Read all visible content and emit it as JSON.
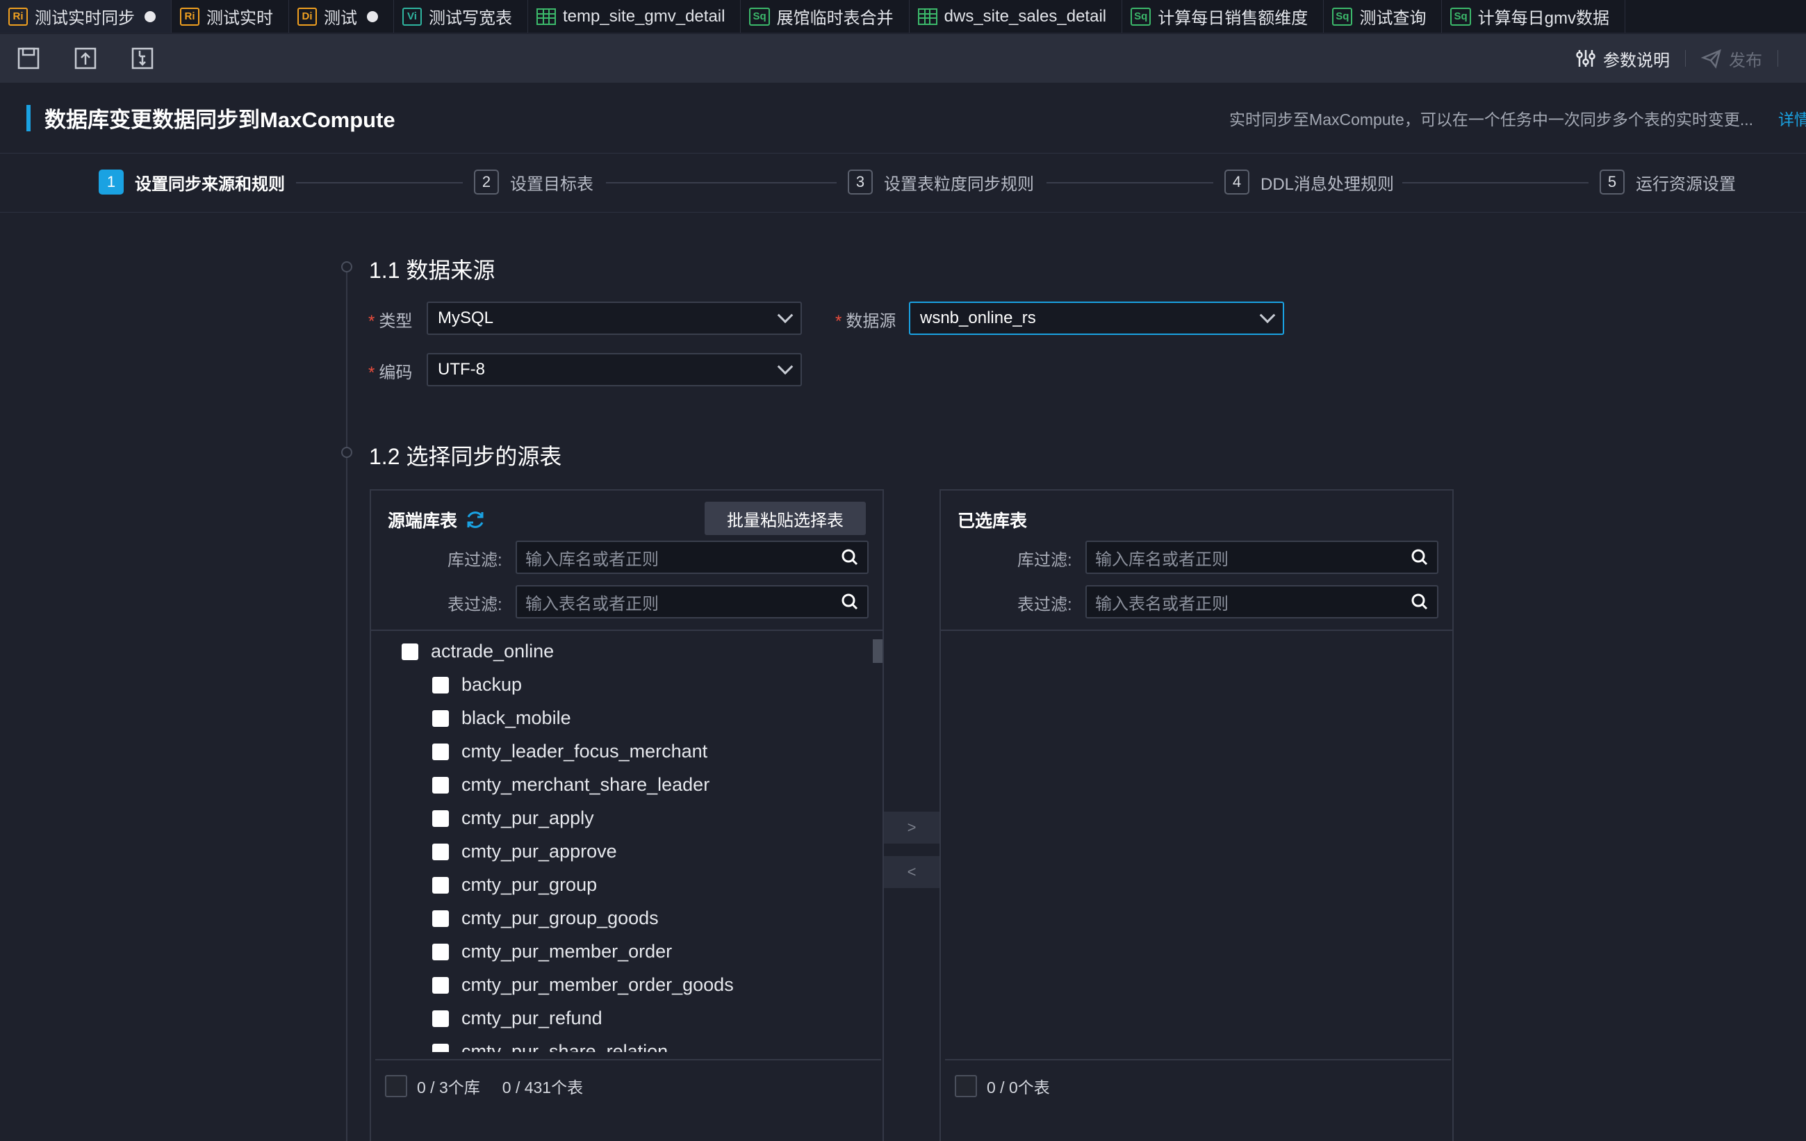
{
  "tabs": [
    {
      "badge": "Ri",
      "badge_color": "#f0a020",
      "label": "测试实时同步",
      "modified": true,
      "active": true,
      "kind": "badge"
    },
    {
      "badge": "Ri",
      "badge_color": "#f0a020",
      "label": "测试实时",
      "modified": false,
      "kind": "badge"
    },
    {
      "badge": "Di",
      "badge_color": "#f0a020",
      "label": "测试",
      "modified": true,
      "kind": "badge"
    },
    {
      "badge": "Vi",
      "badge_color": "#2fb5a0",
      "label": "测试写宽表",
      "modified": false,
      "kind": "badge"
    },
    {
      "badge": "",
      "badge_color": "#3cb96b",
      "label": "temp_site_gmv_detail",
      "modified": false,
      "kind": "grid"
    },
    {
      "badge": "Sq",
      "badge_color": "#3cb96b",
      "label": "展馆临时表合并",
      "modified": false,
      "kind": "badge"
    },
    {
      "badge": "",
      "badge_color": "#3cb96b",
      "label": "dws_site_sales_detail",
      "modified": false,
      "kind": "grid"
    },
    {
      "badge": "Sq",
      "badge_color": "#3cb96b",
      "label": "计算每日销售额维度",
      "modified": false,
      "kind": "badge"
    },
    {
      "badge": "Sq",
      "badge_color": "#3cb96b",
      "label": "测试查询",
      "modified": false,
      "kind": "badge"
    },
    {
      "badge": "Sq",
      "badge_color": "#3cb96b",
      "label": "计算每日gmv数据",
      "modified": false,
      "kind": "badge"
    }
  ],
  "toolbar": {
    "icons": [
      "save-icon",
      "upload-icon",
      "lock-icon"
    ],
    "params_label": "参数说明",
    "publish_label": "发布"
  },
  "header": {
    "title": "数据库变更数据同步到MaxCompute",
    "description": "实时同步至MaxCompute，可以在一个任务中一次同步多个表的实时变更...",
    "link": "详情"
  },
  "steps": [
    {
      "num": "1",
      "label": "设置同步来源和规则"
    },
    {
      "num": "2",
      "label": "设置目标表"
    },
    {
      "num": "3",
      "label": "设置表粒度同步规则"
    },
    {
      "num": "4",
      "label": "DDL消息处理规则"
    },
    {
      "num": "5",
      "label": "运行资源设置"
    }
  ],
  "source": {
    "section_title": "1.1 数据来源",
    "type_label": "类型",
    "type_value": "MySQL",
    "datasource_label": "数据源",
    "datasource_value": "wsnb_online_rs",
    "encoding_label": "编码",
    "encoding_value": "UTF-8",
    "required_mark": "*"
  },
  "tables": {
    "section_title": "1.2 选择同步的源表",
    "left": {
      "title": "源端库表",
      "batch_button": "批量粘贴选择表",
      "db_filter_label": "库过滤:",
      "db_filter_placeholder": "输入库名或者正则",
      "table_filter_label": "表过滤:",
      "table_filter_placeholder": "输入表名或者正则",
      "database": "actrade_online",
      "items": [
        "backup",
        "black_mobile",
        "cmty_leader_focus_merchant",
        "cmty_merchant_share_leader",
        "cmty_pur_apply",
        "cmty_pur_approve",
        "cmty_pur_group",
        "cmty_pur_group_goods",
        "cmty_pur_member_order",
        "cmty_pur_member_order_goods",
        "cmty_pur_refund",
        "cmty_pur_share_relation"
      ],
      "footer_db_count": "0 / 3个库",
      "footer_table_count": "0 / 431个表"
    },
    "transfer": {
      "right_arrow": ">",
      "left_arrow": "<"
    },
    "right": {
      "title": "已选库表",
      "db_filter_label": "库过滤:",
      "db_filter_placeholder": "输入库名或者正则",
      "table_filter_label": "表过滤:",
      "table_filter_placeholder": "输入表名或者正则",
      "footer_count": "0 / 0个表"
    }
  },
  "colors": {
    "accent": "#1aa2e2",
    "required": "#e74c3c",
    "background": "#1e212c"
  }
}
